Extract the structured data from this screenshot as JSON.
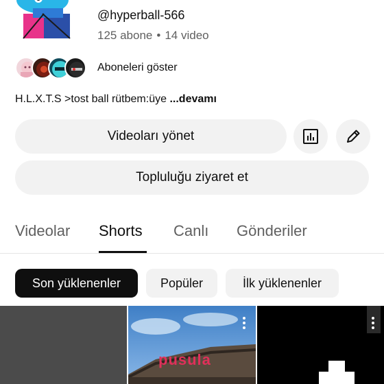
{
  "channel": {
    "handle": "@hyperball-566",
    "subscribers": "125 abone",
    "separator": "•",
    "videos": "14 video"
  },
  "subscribers_row": {
    "label": "Aboneleri göster"
  },
  "description": {
    "text": "H.L.X.T.S >tost ball rütbem:üye",
    "more": "...devamı"
  },
  "actions": {
    "manage_videos": "Videoları yönet",
    "stats_icon": "bar-chart-icon",
    "edit_icon": "pencil-icon",
    "visit_community": "Topluluğu ziyaret et"
  },
  "tabs": [
    {
      "label": "Videolar",
      "active": false
    },
    {
      "label": "Shorts",
      "active": true
    },
    {
      "label": "Canlı",
      "active": false
    },
    {
      "label": "Gönderiler",
      "active": false
    }
  ],
  "filters": [
    {
      "label": "Son yüklenenler",
      "selected": true
    },
    {
      "label": "Popüler",
      "selected": false
    },
    {
      "label": "İlk yüklenenler",
      "selected": false
    }
  ],
  "shorts": [
    {
      "overlay_text": ""
    },
    {
      "overlay_text": "pusula"
    },
    {
      "overlay_text": ""
    }
  ],
  "colors": {
    "text_primary": "#0f0f0f",
    "text_secondary": "#606060",
    "chip_bg": "#f2f2f2",
    "chip_selected_bg": "#0f0f0f",
    "overlay_text": "#e0305a"
  }
}
